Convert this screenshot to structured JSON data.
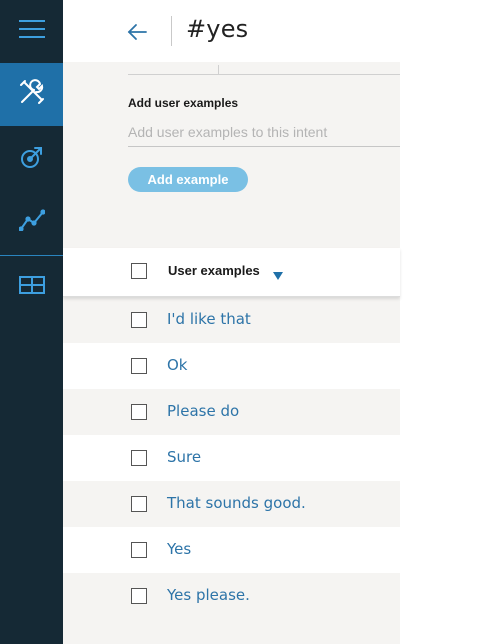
{
  "nav": {
    "items": [
      {
        "icon": "menu-icon"
      },
      {
        "icon": "build-tools-icon",
        "active": true
      },
      {
        "icon": "deploy-icon"
      },
      {
        "icon": "analytics-icon"
      },
      {
        "icon": "workspace-icon"
      }
    ]
  },
  "header": {
    "title": "#yes"
  },
  "add_examples": {
    "label": "Add user examples",
    "placeholder": "Add user examples to this intent",
    "button_label": "Add example"
  },
  "table": {
    "column_header": "User examples",
    "rows": [
      "I'd like that",
      "Ok",
      "Please do",
      "Sure",
      "That sounds good.",
      "Yes",
      "Yes please."
    ]
  },
  "colors": {
    "rail": "#152935",
    "rail_active": "#1f70a8",
    "accent": "#2d74a8",
    "button": "#7ac0e4",
    "panel": "#f5f4f2"
  }
}
